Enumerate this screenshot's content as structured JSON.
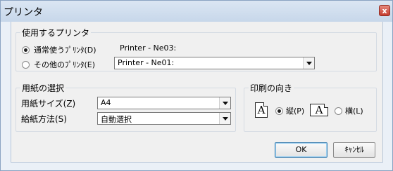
{
  "window": {
    "title": "プリンタ",
    "close_label": "x"
  },
  "printer_group": {
    "legend": "使用するプリンタ",
    "normal_label": "通常使うﾌﾟﾘﾝﾀ(D)",
    "normal_printer": "Printer - Ne03:",
    "other_label": "その他のﾌﾟﾘﾝﾀ(E)",
    "other_printer": "Printer - Ne01:",
    "selected": "normal"
  },
  "paper_group": {
    "legend": "用紙の選択",
    "size_label": "用紙サイズ(Z)",
    "size_value": "A4",
    "feed_label": "給紙方法(S)",
    "feed_value": "自動選択"
  },
  "orientation_group": {
    "legend": "印刷の向き",
    "portrait_label": "縦(P)",
    "landscape_label": "横(L)",
    "icon_letter": "A",
    "selected": "portrait"
  },
  "buttons": {
    "ok": "OK",
    "cancel": "ｷｬﾝｾﾙ"
  }
}
